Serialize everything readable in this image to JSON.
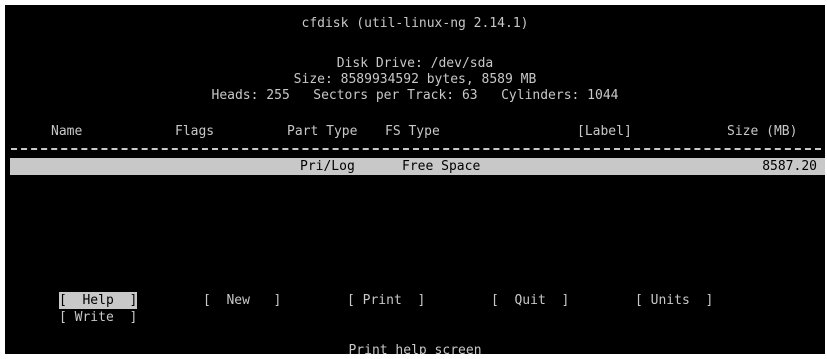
{
  "title": "cfdisk (util-linux-ng 2.14.1)",
  "disk": {
    "drive_line": "Disk Drive: /dev/sda",
    "size_line": "Size: 8589934592 bytes, 8589 MB",
    "geometry_line": "Heads: 255   Sectors per Track: 63   Cylinders: 1044"
  },
  "table": {
    "headers": {
      "name": "Name",
      "flags": "Flags",
      "part_type": "Part Type",
      "fs_type": "FS Type",
      "label": "[Label]",
      "size": "Size (MB)"
    },
    "rows": [
      {
        "name": "",
        "flags": "",
        "part_type": "Pri/Log",
        "fs_type": "Free Space",
        "label": "",
        "size": "8587.20",
        "selected": true
      }
    ]
  },
  "menu": {
    "items": [
      {
        "label": "[  Help  ]",
        "selected": true
      },
      {
        "label": "[  New   ]",
        "selected": false
      },
      {
        "label": "[ Print  ]",
        "selected": false
      },
      {
        "label": "[  Quit  ]",
        "selected": false
      },
      {
        "label": "[ Units  ]",
        "selected": false
      },
      {
        "label": "[ Write  ]",
        "selected": false
      }
    ]
  },
  "status": "Print help screen",
  "colors": {
    "background": "#000000",
    "foreground": "#c8c8c8",
    "highlight_bg": "#c8c8c8",
    "highlight_fg": "#000000"
  }
}
